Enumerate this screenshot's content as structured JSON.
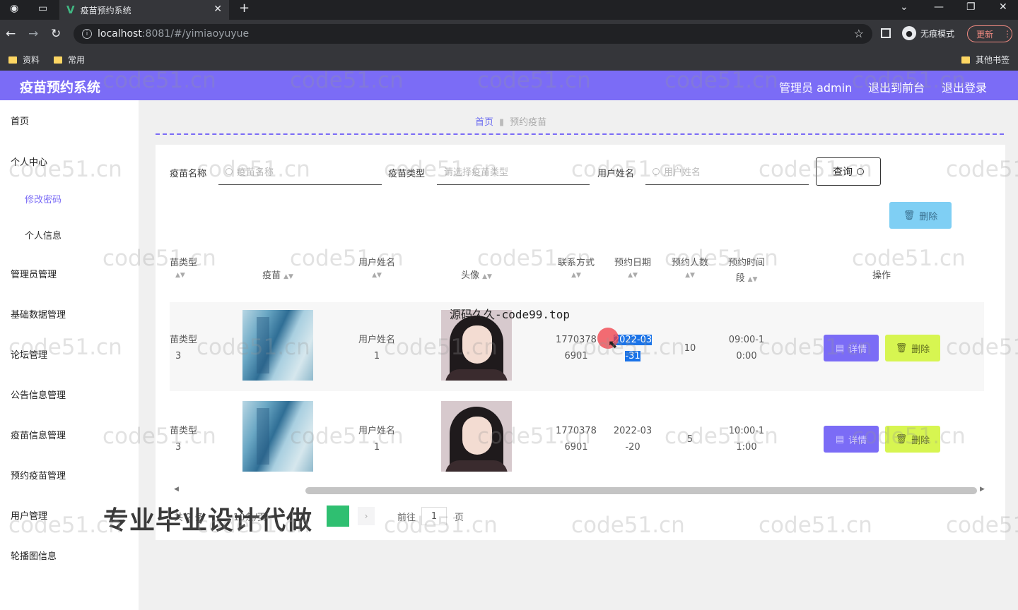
{
  "browser": {
    "tab_title": "疫苗预约系统",
    "url_host": "localhost",
    "url_rest": ":8081/#/yimiaoyuyue",
    "incognito_label": "无痕模式",
    "update_label": "更新",
    "bookmarks": [
      "资料",
      "常用"
    ],
    "other_bookmarks": "其他书签"
  },
  "header": {
    "title": "疫苗预约系统",
    "admin_label": "管理员 admin",
    "to_front": "退出到前台",
    "logout": "退出登录"
  },
  "sidebar": {
    "items": [
      {
        "label": "首页"
      },
      {
        "label": "个人中心"
      },
      {
        "label": "修改密码"
      },
      {
        "label": "个人信息"
      },
      {
        "label": "管理员管理"
      },
      {
        "label": "基础数据管理"
      },
      {
        "label": "论坛管理"
      },
      {
        "label": "公告信息管理"
      },
      {
        "label": "疫苗信息管理"
      },
      {
        "label": "预约疫苗管理"
      },
      {
        "label": "用户管理"
      },
      {
        "label": "轮播图信息"
      }
    ]
  },
  "breadcrumb": {
    "home": "首页",
    "current": "预约疫苗"
  },
  "filters": {
    "vaccine_name_label": "疫苗名称",
    "vaccine_name_placeholder": "疫苗名称",
    "vaccine_type_label": "疫苗类型",
    "vaccine_type_placeholder": "请选择疫苗类型",
    "user_name_label": "用户姓名",
    "user_name_placeholder": "用户姓名",
    "query_label": "查询"
  },
  "toolbar": {
    "delete_label": "删除"
  },
  "table": {
    "headers": {
      "type": "苗类型",
      "vaccine": "疫苗",
      "user_name": "用户姓名",
      "avatar": "头像",
      "contact": "联系方式",
      "date": "预约日期",
      "count": "预约人数",
      "time_a": "预约时间",
      "time_b": "段",
      "action": "操作"
    },
    "rows": [
      {
        "type_a": "苗类型",
        "type_b": "3",
        "user_a": "用户姓名",
        "user_b": "1",
        "phone_a": "1770378",
        "phone_b": "6901",
        "date_a": "2022-03",
        "date_b": "-31",
        "count": "10",
        "time_a": "09:00-1",
        "time_b": "0:00",
        "detail": "详情",
        "delete": "删除"
      },
      {
        "type_a": "苗类型",
        "type_b": "3",
        "user_a": "用户姓名",
        "user_b": "1",
        "phone_a": "1770378",
        "phone_b": "6901",
        "date_a": "2022-03",
        "date_b": "-20",
        "count": "5",
        "time_a": "10:00-1",
        "time_b": "1:00",
        "detail": "详情",
        "delete": "删除"
      }
    ]
  },
  "pager": {
    "total_prefix": "共 2 条",
    "per_page": "10条/页",
    "goto": "前往",
    "page": "1",
    "page_suffix": "页"
  },
  "overlay": {
    "ad_text": "专业毕业设计代做",
    "source_text": "源码久久-code99.top"
  },
  "watermark": "code51.cn",
  "colors": {
    "accent": "#7b6cf6",
    "detail_btn": "#7b6cf6",
    "delete_btn": "#d7f551",
    "delete_top_btn": "#7fcff4"
  }
}
